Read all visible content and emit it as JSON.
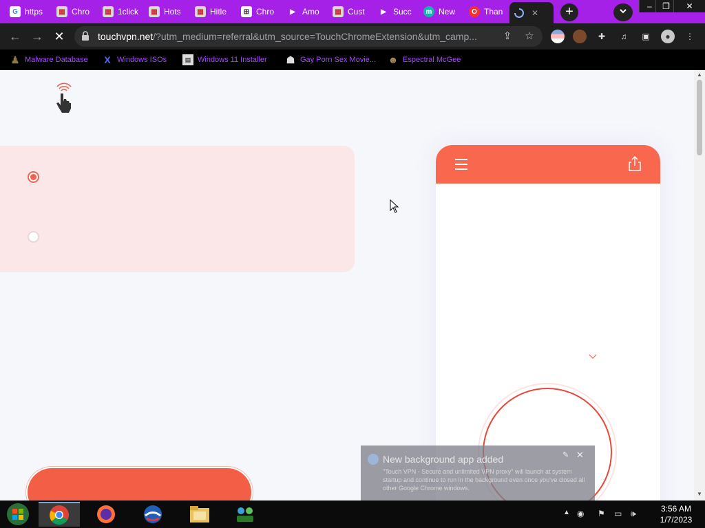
{
  "tabs": [
    {
      "title": "https",
      "favicon": "google-icon"
    },
    {
      "title": "Chro",
      "favicon": "store-icon"
    },
    {
      "title": "1click",
      "favicon": "store-icon"
    },
    {
      "title": "Hots",
      "favicon": "store-icon"
    },
    {
      "title": "Hitle",
      "favicon": "store-icon"
    },
    {
      "title": "Chro",
      "favicon": "apps-grid-icon"
    },
    {
      "title": "Amo",
      "favicon": "play-arrow-icon"
    },
    {
      "title": "Cust",
      "favicon": "store-icon"
    },
    {
      "title": "Succ",
      "favicon": "play-arrow-icon"
    },
    {
      "title": "New",
      "favicon": "m-icon"
    },
    {
      "title": "Than",
      "favicon": "opera-icon"
    }
  ],
  "active_tab": {
    "favicon": "loading-spinner-icon"
  },
  "new_tab_label": "+",
  "address_bar": {
    "host": "touchvpn.net",
    "path": "/?utm_medium=referral&utm_source=TouchChromeExtension&utm_camp..."
  },
  "bookmarks": [
    {
      "label": "Malware Database",
      "icon": "figure-icon"
    },
    {
      "label": "Windows ISOs",
      "icon": "x-icon"
    },
    {
      "label": "Windows 11 Installer",
      "icon": "image-icon"
    },
    {
      "label": "Gay Porn Sex Movie...",
      "icon": "ghost-icon"
    },
    {
      "label": "Espectral McGee",
      "icon": "character-icon"
    }
  ],
  "notification": {
    "title": "New background app added",
    "body": "\"Touch VPN - Secure and unlimited VPN proxy\" will launch at system startup and continue to run in the background even once you've closed all other Google Chrome windows."
  },
  "clock": {
    "time": "3:56 AM",
    "date": "1/7/2023"
  },
  "colors": {
    "accent": "#f9674f",
    "tab_strip": "#a621e8",
    "bookmark_text": "#a647ff"
  },
  "options": [
    {
      "selected": true
    },
    {
      "selected": false
    }
  ]
}
